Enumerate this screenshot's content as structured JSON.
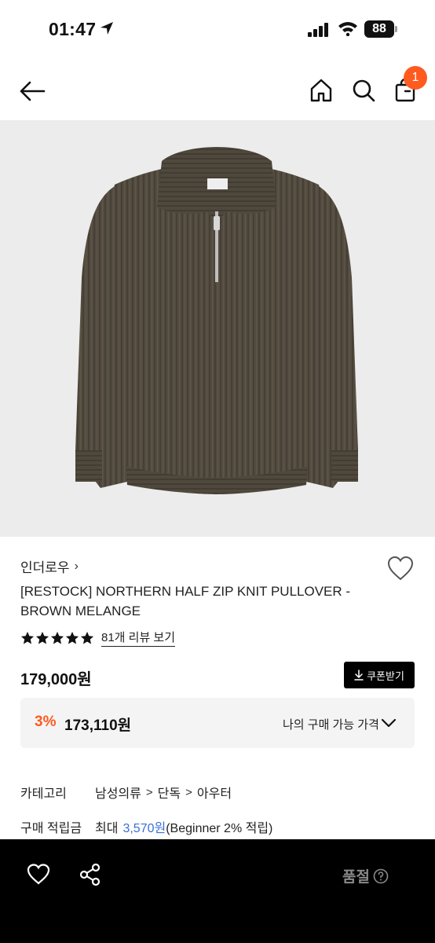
{
  "status_bar": {
    "time": "01:47",
    "battery": "88"
  },
  "header": {
    "cart_count": "1"
  },
  "product": {
    "brand": "인더로우",
    "title": "[RESTOCK] NORTHERN HALF ZIP KNIT PULLOVER - BROWN MELANGE",
    "review_link": "81개 리뷰 보기",
    "rating_stars": 5,
    "price": "179,000원",
    "coupon_label": "쿠폰받기"
  },
  "my_price": {
    "discount_rate": "3%",
    "discount_price": "173,110원",
    "label": "나의 구매 가능 가격"
  },
  "info": {
    "category_label": "카테고리",
    "category_path": [
      "남성의류",
      "단독",
      "아우터"
    ],
    "points_label": "구매 적립금",
    "points_prefix": "최대",
    "points_amount": "3,570원",
    "points_suffix": "(Beginner 2% 적립)"
  },
  "bottom_bar": {
    "soldout_label": "품절"
  },
  "colors": {
    "accent_orange": "#ff5a1f",
    "accent_blue": "#3a6fd8",
    "sweater": "#544c40"
  }
}
